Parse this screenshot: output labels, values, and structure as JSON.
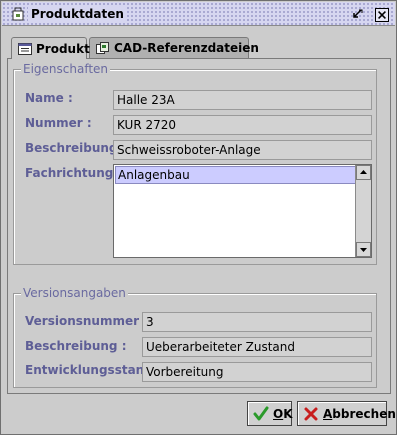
{
  "window": {
    "title": "Produktdaten"
  },
  "tabs": [
    {
      "label": "Produkt"
    },
    {
      "label": "CAD-Referenzdateien"
    }
  ],
  "eigenschaften": {
    "legend": "Eigenschaften",
    "name_label": "Name :",
    "name_value": "Halle 23A",
    "nummer_label": "Nummer :",
    "nummer_value": "KUR 2720",
    "beschreibung_label": "Beschreibung :",
    "beschreibung_value": "Schweissroboter-Anlage",
    "fachrichtung_label": "Fachrichtung :",
    "fachrichtung_items": [
      "Anlagenbau"
    ]
  },
  "versionsangaben": {
    "legend": "Versionsangaben",
    "versionsnummer_label": "Versionsnummer :",
    "versionsnummer_value": "3",
    "beschreibung_label": "Beschreibung :",
    "beschreibung_value": "Ueberarbeiteter Zustand",
    "entwicklungsstand_label": "Entwicklungsstand :",
    "entwicklungsstand_value": "Vorbereitung"
  },
  "buttons": {
    "ok_first": "O",
    "ok_rest": "K",
    "cancel_first": "A",
    "cancel_rest": "bbrechen"
  },
  "colors": {
    "label": "#5e5e96",
    "titlebar": "#d6d6f0",
    "selection": "#ccccff"
  }
}
